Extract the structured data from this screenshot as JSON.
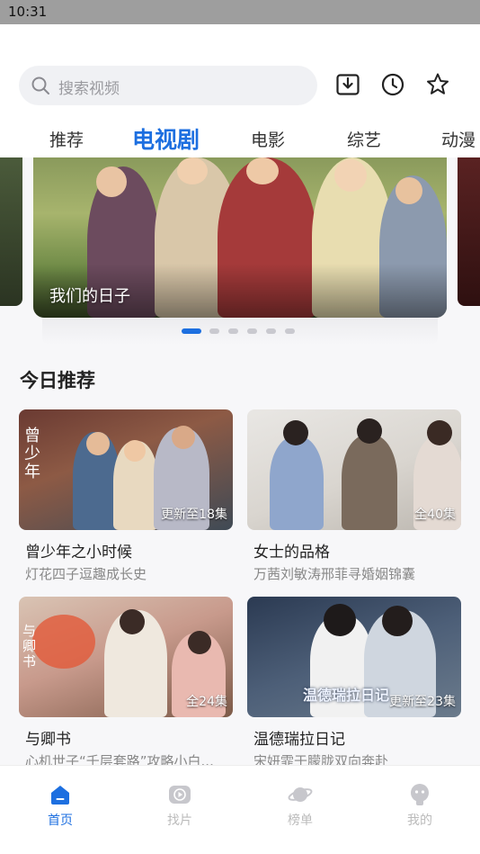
{
  "status_bar": {
    "time": "10:31"
  },
  "search": {
    "placeholder": "搜索视频"
  },
  "tabs": [
    "推荐",
    "电视剧",
    "电影",
    "综艺",
    "动漫"
  ],
  "banner": {
    "caption": "我们的日子",
    "page_count": 6,
    "active_page": 1
  },
  "recommend": {
    "title": "今日推荐",
    "cards": [
      {
        "title": "曾少年之小时候",
        "subtitle": "灯花四子逗趣成长史",
        "badge": "更新至18集",
        "poster_text": "曾少年"
      },
      {
        "title": "女士的品格",
        "subtitle": "万茜刘敏涛邢菲寻婚姻锦囊",
        "badge": "全40集",
        "poster_text": ""
      },
      {
        "title": "与卿书",
        "subtitle": "心机世子“千层套路”攻略小白...",
        "badge": "全24集",
        "poster_text": "与卿书"
      },
      {
        "title": "温德瑞拉日记",
        "subtitle": "宋妍霏于朦胧双向奔赴",
        "badge": "更新至23集",
        "poster_text": "温德瑞拉日记"
      }
    ]
  },
  "bottom_nav": [
    {
      "label": "首页",
      "icon": "home-icon",
      "active": true
    },
    {
      "label": "找片",
      "icon": "play-icon",
      "active": false
    },
    {
      "label": "榜单",
      "icon": "planet-icon",
      "active": false
    },
    {
      "label": "我的",
      "icon": "profile-icon",
      "active": false
    }
  ],
  "colors": {
    "accent": "#1d6fe0",
    "inactive": "#bbbbbb",
    "background": "#f7f7f9"
  }
}
